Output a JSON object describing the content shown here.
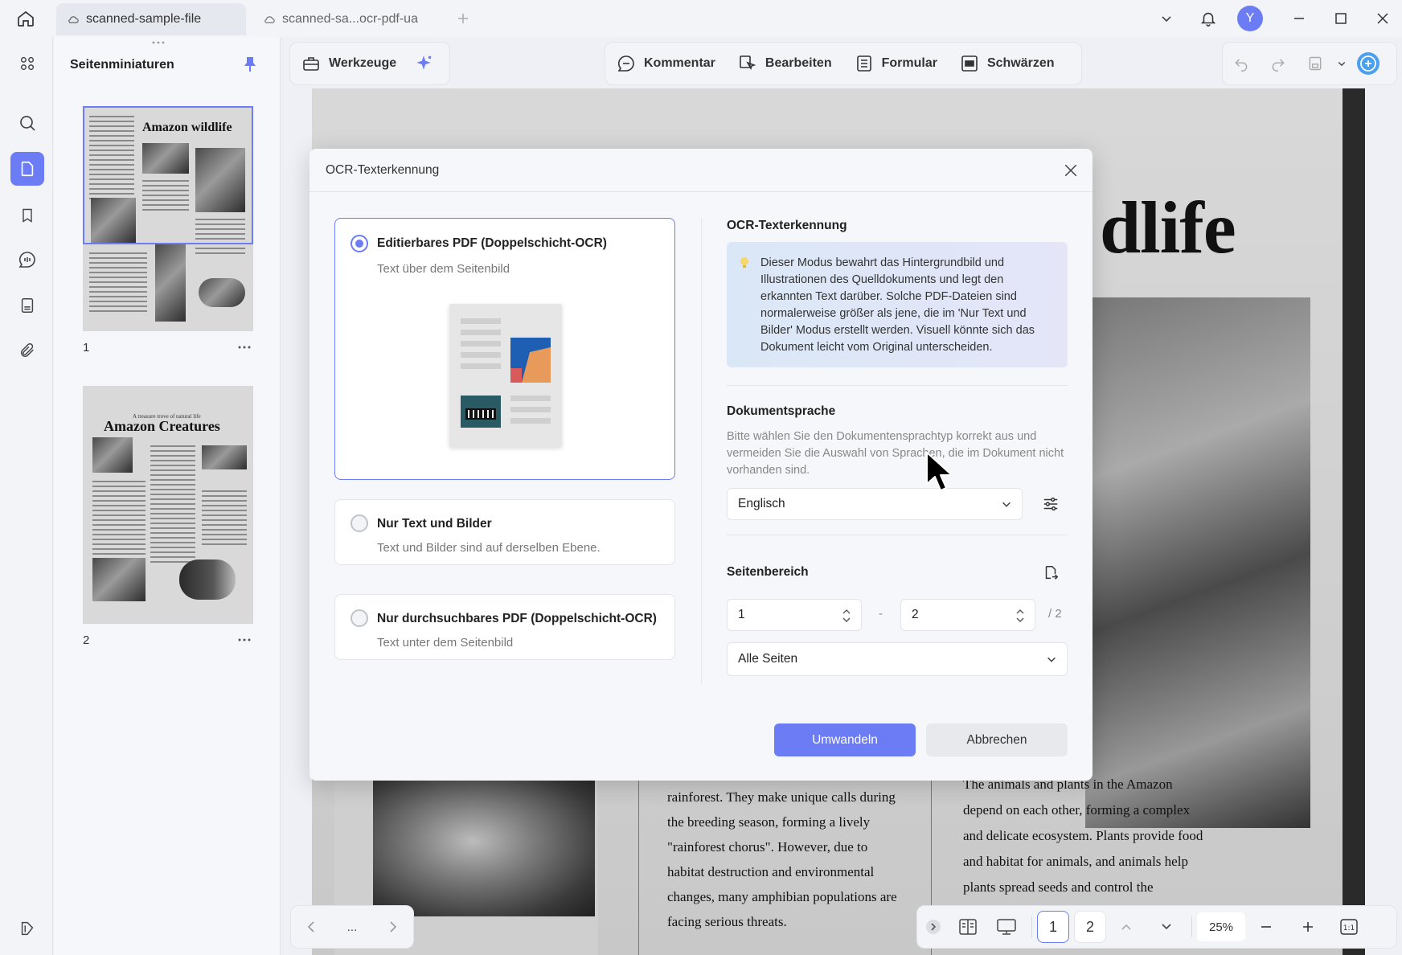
{
  "titlebar": {
    "tabs": [
      {
        "label": "scanned-sample-file"
      },
      {
        "label": "scanned-sa...ocr-pdf-ua"
      }
    ],
    "avatar_initial": "Y"
  },
  "thumbnails": {
    "title": "Seitenminiaturen",
    "pages": [
      {
        "number": "1",
        "heading": "Amazon wildlife"
      },
      {
        "number": "2",
        "heading": "Amazon Creatures",
        "kicker": "A treasure trove of natural life"
      }
    ]
  },
  "toolbar": {
    "werkzeuge": "Werkzeuge",
    "kommentar": "Kommentar",
    "bearbeiten": "Bearbeiten",
    "formular": "Formular",
    "schwaerzen": "Schwärzen"
  },
  "document": {
    "heading_fragment": "dlife",
    "column_middle": [
      "rainforest. They make unique calls during",
      "the breeding season, forming a lively",
      "\"rainforest chorus\". However, due to",
      "habitat destruction and environmental",
      "changes, many amphibian populations are",
      "facing serious threats."
    ],
    "column_right": [
      "The animals and plants in the Amazon",
      "depend on each other, forming a complex",
      "and delicate ecosystem. Plants provide food",
      "and habitat for animals, and animals help",
      "plants spread seeds and control the"
    ]
  },
  "modal": {
    "title": "OCR-Texterkennung",
    "options": [
      {
        "title": "Editierbares PDF (Doppelschicht-OCR)",
        "desc": "Text über dem Seitenbild"
      },
      {
        "title": "Nur Text und Bilder",
        "desc": "Text und Bilder sind auf derselben Ebene."
      },
      {
        "title": "Nur durchsuchbares PDF (Doppelschicht-OCR)",
        "desc": "Text unter dem Seitenbild"
      }
    ],
    "info_heading": "OCR-Texterkennung",
    "info_text": "Dieser Modus bewahrt das Hintergrundbild und Illustrationen des Quelldokuments und legt den erkannten Text darüber. Solche PDF-Dateien sind normalerweise größer als jene, die im 'Nur Text und Bilder' Modus erstellt werden. Visuell könnte sich das Dokument leicht vom Original unterscheiden.",
    "language_heading": "Dokumentsprache",
    "language_hint": "Bitte wählen Sie den Dokumentensprachtyp korrekt aus und vermeiden Sie die Auswahl von Sprachen, die im Dokument nicht vorhanden sind.",
    "language_value": "Englisch",
    "range_heading": "Seitenbereich",
    "range_from": "1",
    "range_sep": "-",
    "range_to": "2",
    "range_total": "/ 2",
    "pages_value": "Alle Seiten",
    "convert_label": "Umwandeln",
    "cancel_label": "Abbrechen"
  },
  "bottom": {
    "ellipsis": "...",
    "page_buttons": [
      "1",
      "2"
    ],
    "zoom": "25%"
  },
  "colors": {
    "accent": "#6b7cf5",
    "info_bg": "#dde8f8"
  }
}
